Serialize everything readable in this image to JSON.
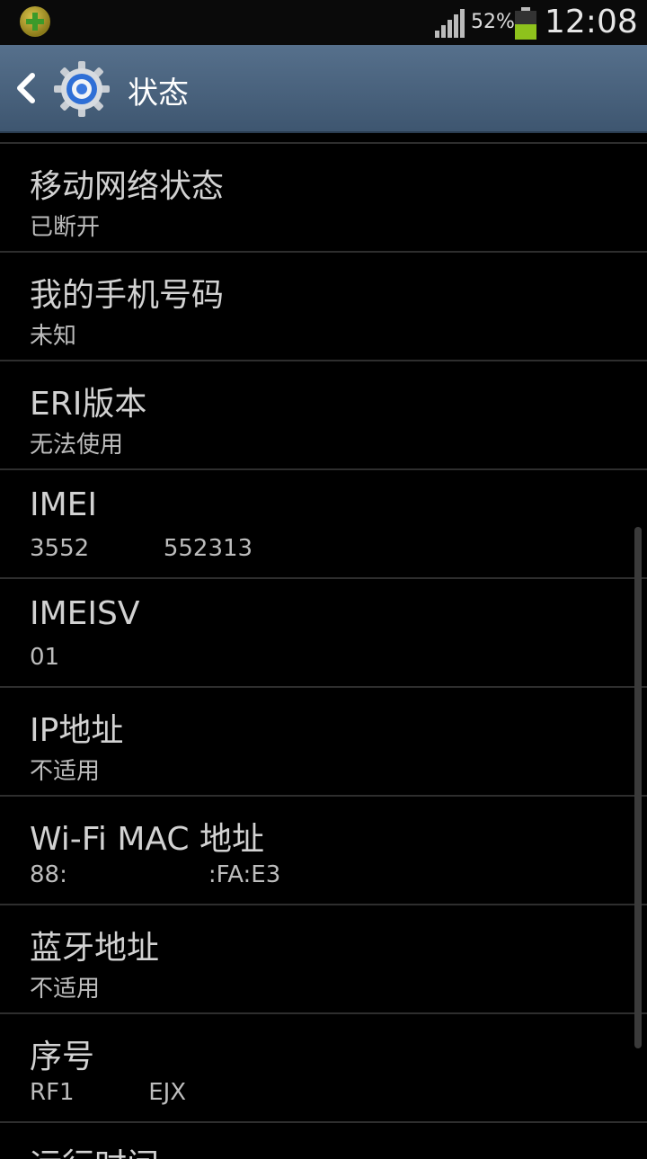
{
  "status_bar": {
    "battery_percent": "52%",
    "battery_level": 0.52,
    "time": "12:08"
  },
  "action_bar": {
    "title": "状态"
  },
  "items": [
    {
      "title": "移动网络状态",
      "value": "已断开"
    },
    {
      "title": "我的手机号码",
      "value": "未知"
    },
    {
      "title": "ERI版本",
      "value": "无法使用"
    },
    {
      "title": "IMEI",
      "value": "3552          552313"
    },
    {
      "title": "IMEISV",
      "value": "01"
    },
    {
      "title": "IP地址",
      "value": "不适用"
    },
    {
      "title": "Wi-Fi MAC 地址",
      "value": "88:                   :FA:E3"
    },
    {
      "title": "蓝牙地址",
      "value": "不适用"
    },
    {
      "title": "序号",
      "value": "RF1          EJX"
    }
  ],
  "partial_item": {
    "title": "运行时间"
  },
  "colors": {
    "action_bar": "#4a637e",
    "battery_fill": "#8ec21c",
    "background": "#000000"
  }
}
